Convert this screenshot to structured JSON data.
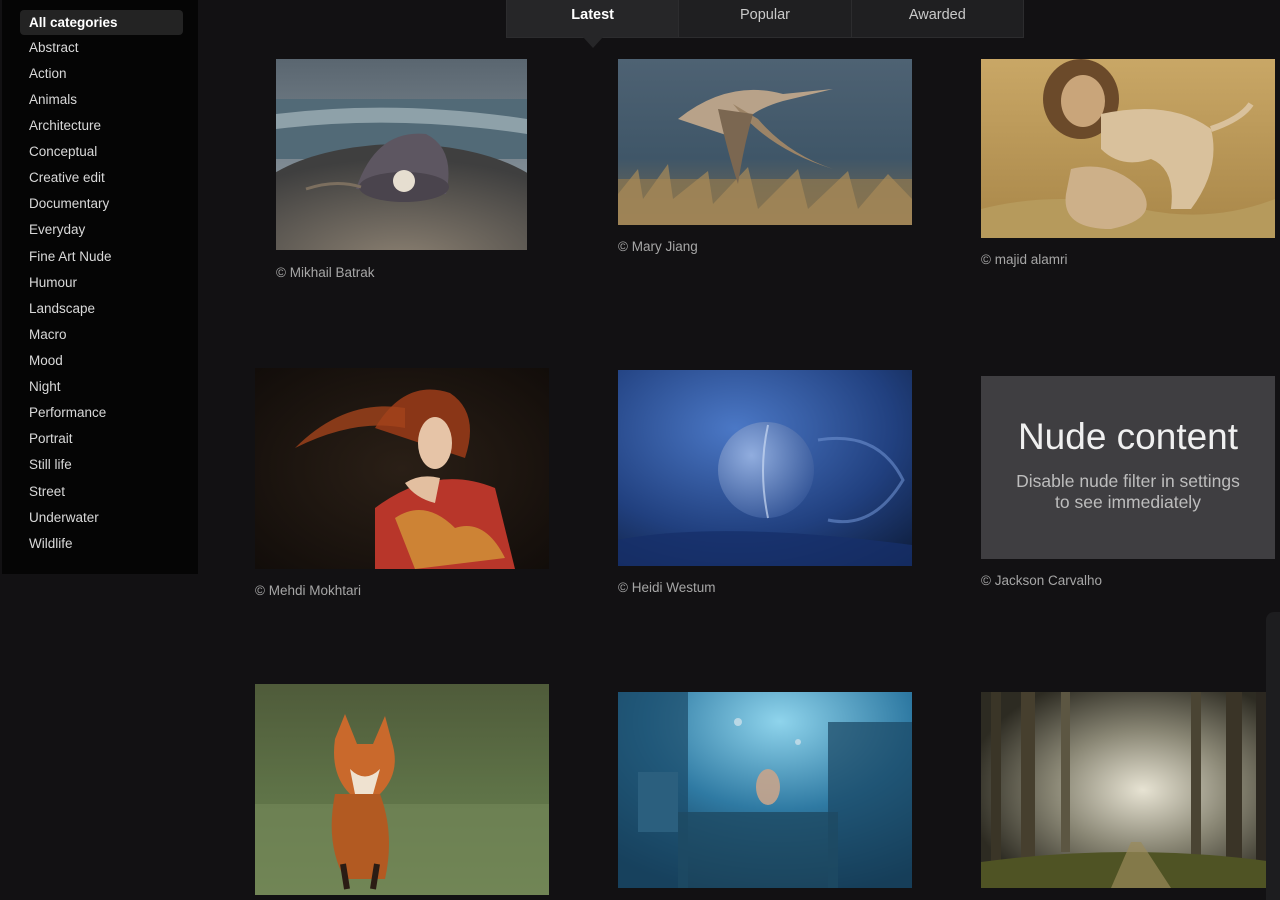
{
  "categories": [
    "All categories",
    "Abstract",
    "Action",
    "Animals",
    "Architecture",
    "Conceptual",
    "Creative edit",
    "Documentary",
    "Everyday",
    "Fine Art Nude",
    "Humour",
    "Landscape",
    "Macro",
    "Mood",
    "Night",
    "Performance",
    "Portrait",
    "Still life",
    "Street",
    "Underwater",
    "Wildlife"
  ],
  "active_category": "All categories",
  "tabs": [
    "Latest",
    "Popular",
    "Awarded"
  ],
  "active_tab": "Latest",
  "photos": [
    {
      "credit": "© Mikhail Batrak",
      "subject": "pearl-oyster-on-beach"
    },
    {
      "credit": "© Mary Jiang",
      "subject": "flying-crane"
    },
    {
      "credit": "© majid alamri",
      "subject": "lions"
    },
    {
      "credit": "© Mehdi Mokhtari",
      "subject": "red-haired-woman-portrait"
    },
    {
      "credit": "© Heidi Westum",
      "subject": "blue-abstract-bubble"
    },
    {
      "credit": "© Jackson Carvalho",
      "subject": "nude-content-placeholder",
      "nude_title": "Nude content",
      "nude_line1": "Disable nude filter in settings",
      "nude_line2": "to see immediately"
    },
    {
      "credit": "",
      "subject": "red-fox"
    },
    {
      "credit": "",
      "subject": "underwater-kitchen"
    },
    {
      "credit": "",
      "subject": "misty-forest-path"
    }
  ],
  "colors": {
    "background": "#121113",
    "sidebar": "#050505",
    "tab_bar": "#1f1f21",
    "credit_text": "#a6a6a6"
  }
}
